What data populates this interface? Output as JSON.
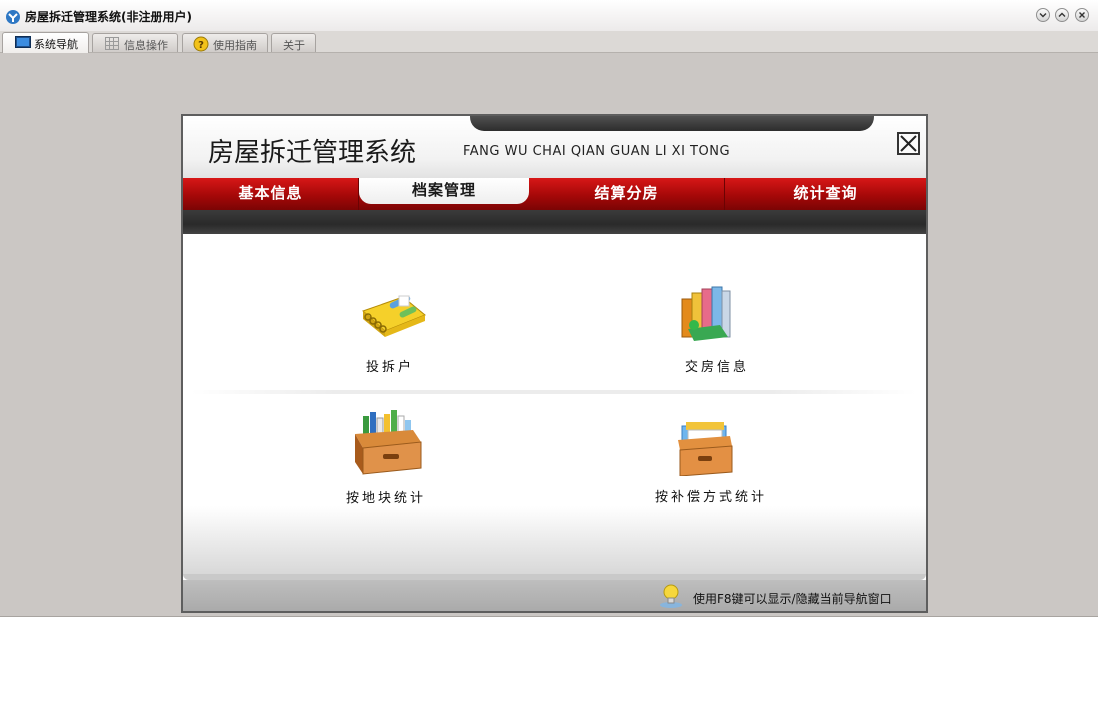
{
  "window": {
    "title": "房屋拆迁管理系统(非注册用户)"
  },
  "tabs": [
    {
      "label": "系统导航",
      "icon": "monitor-icon",
      "active": true
    },
    {
      "label": "信息操作",
      "icon": "grid-icon",
      "active": false
    },
    {
      "label": "使用指南",
      "icon": "help-icon",
      "active": false
    },
    {
      "label": "关于",
      "icon": "",
      "active": false
    }
  ],
  "panel": {
    "title": "房屋拆迁管理系统",
    "pinyin": "FANG WU CHAI QIAN GUAN LI XI TONG",
    "menu": [
      {
        "label": "基本信息",
        "active": false
      },
      {
        "label": "档案管理",
        "active": true
      },
      {
        "label": "结算分房",
        "active": false
      },
      {
        "label": "统计查询",
        "active": false
      }
    ],
    "items": [
      {
        "label": "投拆户",
        "icon": "notebook-icon"
      },
      {
        "label": "交房信息",
        "icon": "books-icon"
      },
      {
        "label": "按地块统计",
        "icon": "file-box-icon"
      },
      {
        "label": "按补偿方式统计",
        "icon": "folder-box-icon"
      }
    ],
    "footer_hint": "使用F8键可以显示/隐藏当前导航窗口"
  },
  "colors": {
    "menu_red": "#b00b0b",
    "window_bg": "#cbc7c4"
  }
}
